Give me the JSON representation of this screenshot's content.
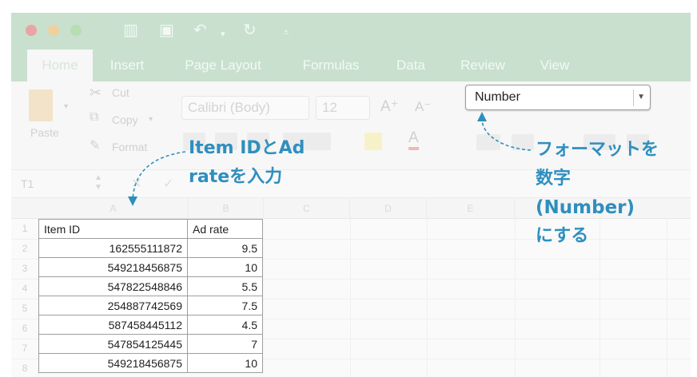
{
  "toolbar": {
    "tabs": [
      "Home",
      "Insert",
      "Page Layout",
      "Formulas",
      "Data",
      "Review",
      "View"
    ],
    "clipboard": {
      "paste": "Paste",
      "cut": "Cut",
      "copy": "Copy",
      "format": "Format"
    },
    "font_name": "Calibri (Body)",
    "font_size": "12",
    "number_format": "Number"
  },
  "formula_bar": {
    "name_box": "T1"
  },
  "sheet": {
    "columns": [
      "A",
      "B",
      "C",
      "D",
      "E"
    ],
    "row_numbers": [
      "1",
      "2",
      "3",
      "4",
      "5",
      "6",
      "7",
      "8"
    ],
    "header": [
      "Item ID",
      "Ad rate"
    ],
    "rows": [
      [
        "162555111872",
        "9.5"
      ],
      [
        "549218456875",
        "10"
      ],
      [
        "547822548846",
        "5.5"
      ],
      [
        "254887742569",
        "7.5"
      ],
      [
        "587458445112",
        "4.5"
      ],
      [
        "547854125445",
        "7"
      ],
      [
        "549218456875",
        "10"
      ]
    ]
  },
  "annotations": {
    "left_line1": "Item IDとAd",
    "left_line2": "rateを入力",
    "right_line1": "フォーマットを",
    "right_line2": "数字",
    "right_line3": "(Number)",
    "right_line4": "にする"
  },
  "colors": {
    "accent": "#2e8fbf",
    "title_green": "#c9e0cf"
  },
  "icons": [
    "close-dot",
    "minimize-dot",
    "zoom-dot",
    "sidebar-icon",
    "save-icon",
    "undo-icon",
    "redo-icon",
    "customize-icon",
    "scissors-icon",
    "copy-icon",
    "brush-icon",
    "clipboard-icon"
  ]
}
